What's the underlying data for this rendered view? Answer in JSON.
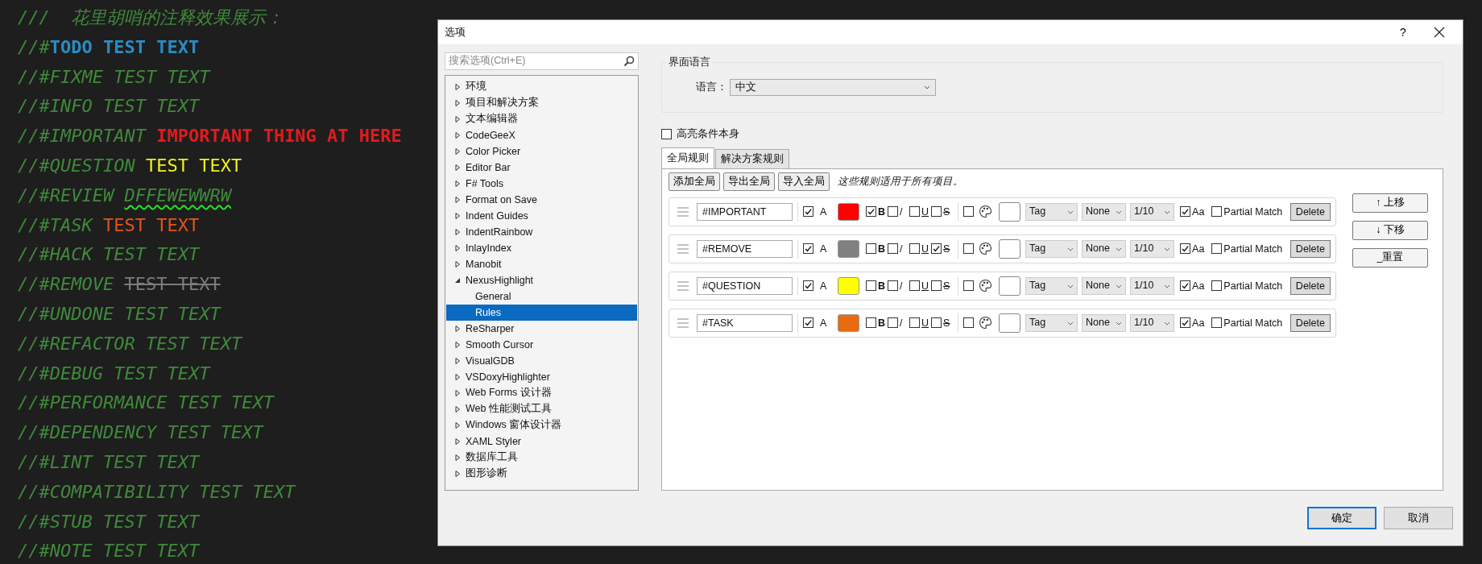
{
  "editor": {
    "lines": [
      {
        "prefix": "///  花里胡哨的注释效果展示：",
        "kind": "doc"
      },
      {
        "prefix": "//#",
        "highlight": "TODO TEST TEXT",
        "kind": "todo"
      },
      {
        "prefix": "//#FIXME TEST TEXT",
        "kind": "plain"
      },
      {
        "prefix": "//#INFO TEST TEXT",
        "kind": "plain"
      },
      {
        "prefix": "//#IMPORTANT ",
        "highlight": "IMPORTANT THING AT HERE",
        "kind": "important"
      },
      {
        "prefix": "//#QUESTION ",
        "highlight": "TEST TEXT",
        "kind": "question"
      },
      {
        "prefix": "//#REVIEW ",
        "highlight": "DFFEWEWWRW",
        "kind": "review"
      },
      {
        "prefix": "//#TASK ",
        "highlight": "TEST TEXT",
        "kind": "task"
      },
      {
        "prefix": "//#HACK TEST TEXT",
        "kind": "plain"
      },
      {
        "prefix": "//#REMOVE ",
        "highlight": "TEST TEXT",
        "kind": "remove"
      },
      {
        "prefix": "//#UNDONE TEST TEXT",
        "kind": "plain"
      },
      {
        "prefix": "//#REFACTOR TEST TEXT",
        "kind": "plain"
      },
      {
        "prefix": "//#DEBUG TEST TEXT",
        "kind": "plain"
      },
      {
        "prefix": "//#PERFORMANCE TEST TEXT",
        "kind": "plain"
      },
      {
        "prefix": "//#DEPENDENCY TEST TEXT",
        "kind": "plain"
      },
      {
        "prefix": "//#LINT TEST TEXT",
        "kind": "plain"
      },
      {
        "prefix": "//#COMPATIBILITY TEST TEXT",
        "kind": "plain"
      },
      {
        "prefix": "//#STUB TEST TEXT",
        "kind": "plain"
      },
      {
        "prefix": "//#NOTE TEST TEXT",
        "kind": "plain"
      }
    ]
  },
  "dialog": {
    "title": "选项",
    "help": "?",
    "search": {
      "placeholder": "搜索选项(Ctrl+E)"
    },
    "tree": [
      {
        "label": "环境",
        "expanded": false,
        "selected": false
      },
      {
        "label": "项目和解决方案",
        "expanded": false,
        "selected": false
      },
      {
        "label": "文本编辑器",
        "expanded": false,
        "selected": false
      },
      {
        "label": "CodeGeeX",
        "expanded": false,
        "selected": false
      },
      {
        "label": "Color Picker",
        "expanded": false,
        "selected": false
      },
      {
        "label": "Editor Bar",
        "expanded": false,
        "selected": false
      },
      {
        "label": "F# Tools",
        "expanded": false,
        "selected": false
      },
      {
        "label": "Format on Save",
        "expanded": false,
        "selected": false
      },
      {
        "label": "Indent Guides",
        "expanded": false,
        "selected": false
      },
      {
        "label": "IndentRainbow",
        "expanded": false,
        "selected": false
      },
      {
        "label": "InlayIndex",
        "expanded": false,
        "selected": false
      },
      {
        "label": "Manobit",
        "expanded": false,
        "selected": false
      },
      {
        "label": "NexusHighlight",
        "expanded": true,
        "selected": false,
        "children": [
          {
            "label": "General",
            "selected": false
          },
          {
            "label": "Rules",
            "selected": true
          }
        ]
      },
      {
        "label": "ReSharper",
        "expanded": false,
        "selected": false
      },
      {
        "label": "Smooth Cursor",
        "expanded": false,
        "selected": false
      },
      {
        "label": "VisualGDB",
        "expanded": false,
        "selected": false
      },
      {
        "label": "VSDoxyHighlighter",
        "expanded": false,
        "selected": false
      },
      {
        "label": "Web Forms 设计器",
        "expanded": false,
        "selected": false
      },
      {
        "label": "Web 性能测试工具",
        "expanded": false,
        "selected": false
      },
      {
        "label": "Windows 窗体设计器",
        "expanded": false,
        "selected": false
      },
      {
        "label": "XAML Styler",
        "expanded": false,
        "selected": false
      },
      {
        "label": "数据库工具",
        "expanded": false,
        "selected": false
      },
      {
        "label": "图形诊断",
        "expanded": false,
        "selected": false
      }
    ],
    "language_group": {
      "title": "界面语言",
      "label": "语言：",
      "value": "中文"
    },
    "highlight_condition": {
      "label": "高亮条件本身",
      "checked": false
    },
    "tabs": [
      {
        "label": "全局规则",
        "selected": true
      },
      {
        "label": "解决方案规则",
        "selected": false
      }
    ],
    "toolbar": [
      "添加全局",
      "导出全局",
      "导入全局"
    ],
    "note": "这些规则适用于所有项目。",
    "rules": [
      {
        "pattern": "#IMPORTANT",
        "enabled": true,
        "enabled_label": "A",
        "color": "#ff0000",
        "toggles": [
          {
            "kind": "bold",
            "label": "B",
            "checked": true
          },
          {
            "kind": "italic",
            "label": "/",
            "checked": false
          },
          {
            "kind": "underline",
            "label": "U",
            "checked": false
          },
          {
            "kind": "strike",
            "label": "S",
            "checked": false
          }
        ],
        "background": false,
        "selects": [
          "Tag",
          "None",
          "1/10"
        ],
        "match_case": true,
        "case_label": "Aa",
        "partial_match": false,
        "partial_label": "Partial Match",
        "delete": "Delete"
      },
      {
        "pattern": "#REMOVE",
        "enabled": true,
        "enabled_label": "A",
        "color": "#808080",
        "toggles": [
          {
            "kind": "bold",
            "label": "B",
            "checked": false
          },
          {
            "kind": "italic",
            "label": "/",
            "checked": false
          },
          {
            "kind": "underline",
            "label": "U",
            "checked": false
          },
          {
            "kind": "strike",
            "label": "S",
            "checked": true
          }
        ],
        "background": false,
        "selects": [
          "Tag",
          "None",
          "1/10"
        ],
        "match_case": true,
        "case_label": "Aa",
        "partial_match": false,
        "partial_label": "Partial Match",
        "delete": "Delete"
      },
      {
        "pattern": "#QUESTION",
        "enabled": true,
        "enabled_label": "A",
        "color": "#ffff00",
        "toggles": [
          {
            "kind": "bold",
            "label": "B",
            "checked": false
          },
          {
            "kind": "italic",
            "label": "/",
            "checked": false
          },
          {
            "kind": "underline",
            "label": "U",
            "checked": false
          },
          {
            "kind": "strike",
            "label": "S",
            "checked": false
          }
        ],
        "background": false,
        "selects": [
          "Tag",
          "None",
          "1/10"
        ],
        "match_case": true,
        "case_label": "Aa",
        "partial_match": false,
        "partial_label": "Partial Match",
        "delete": "Delete"
      },
      {
        "pattern": "#TASK",
        "enabled": true,
        "enabled_label": "A",
        "color": "#ea6a10",
        "toggles": [
          {
            "kind": "bold",
            "label": "B",
            "checked": false
          },
          {
            "kind": "italic",
            "label": "/",
            "checked": false
          },
          {
            "kind": "underline",
            "label": "U",
            "checked": false
          },
          {
            "kind": "strike",
            "label": "S",
            "checked": false
          }
        ],
        "background": false,
        "selects": [
          "Tag",
          "None",
          "1/10"
        ],
        "match_case": true,
        "case_label": "Aa",
        "partial_match": false,
        "partial_label": "Partial Match",
        "delete": "Delete"
      }
    ],
    "side_buttons": [
      "↑ 上移",
      "↓ 下移",
      "_重置"
    ],
    "footer": [
      {
        "label": "确定",
        "kind": "default"
      },
      {
        "label": "取消",
        "kind": "normal"
      }
    ]
  }
}
